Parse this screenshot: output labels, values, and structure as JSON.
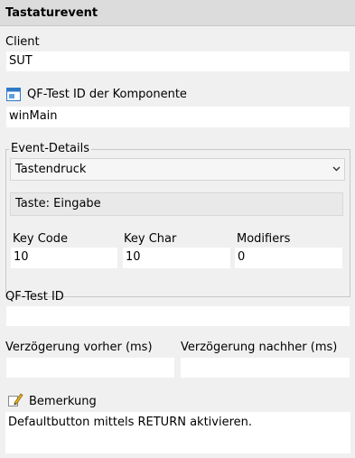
{
  "header": {
    "title": "Tastaturevent"
  },
  "client": {
    "label": "Client",
    "value": "SUT"
  },
  "component": {
    "label": "QF-Test ID der Komponente",
    "value": "winMain",
    "icon": "component-id-icon"
  },
  "event_details": {
    "legend": "Event-Details",
    "type_value": "Tastendruck",
    "key_text": "Taste: Eingabe",
    "key_code": {
      "label": "Key Code",
      "value": "10"
    },
    "key_char": {
      "label": "Key Char",
      "value": "10"
    },
    "modifiers": {
      "label": "Modifiers",
      "value": "0"
    }
  },
  "qftest_id": {
    "label": "QF-Test ID",
    "value": ""
  },
  "delay_before": {
    "label": "Verzögerung vorher (ms)",
    "value": ""
  },
  "delay_after": {
    "label": "Verzögerung nachher (ms)",
    "value": ""
  },
  "comment": {
    "label": "Bemerkung",
    "value": "Defaultbutton mittels RETURN aktivieren.",
    "icon": "pencil-icon"
  }
}
